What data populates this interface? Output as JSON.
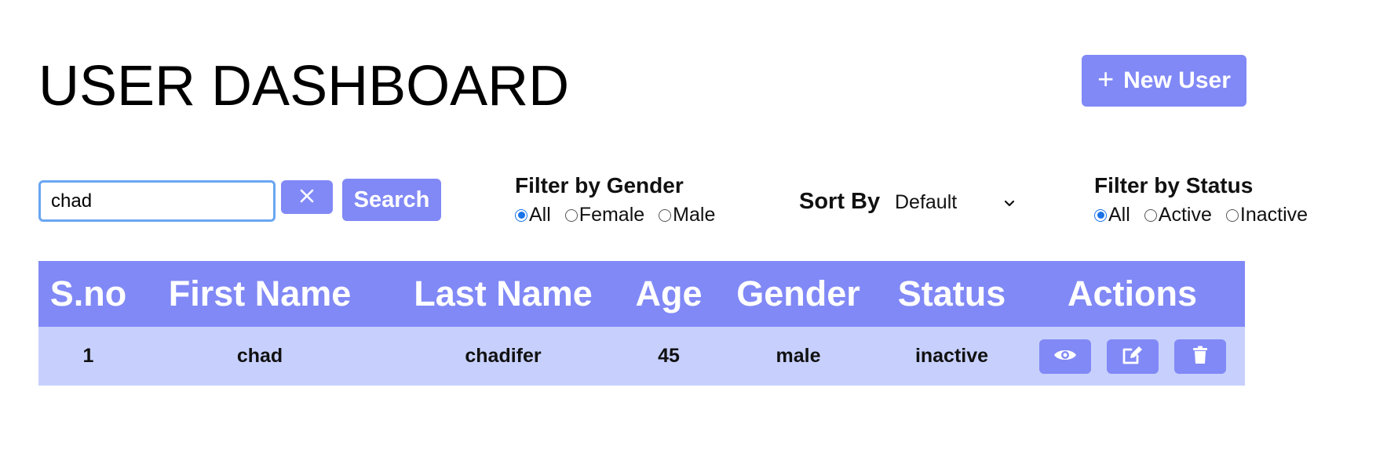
{
  "header": {
    "title": "USER DASHBOARD",
    "new_user_label": "New User",
    "new_user_icon": "plus-icon"
  },
  "search": {
    "value": "chad",
    "placeholder": "",
    "clear_icon": "close-icon",
    "button_label": "Search"
  },
  "gender_filter": {
    "title": "Filter by Gender",
    "options": [
      "All",
      "Female",
      "Male"
    ],
    "selected": "All"
  },
  "sort": {
    "label": "Sort By",
    "selected": "Default",
    "icon": "chevron-down-icon"
  },
  "status_filter": {
    "title": "Filter by Status",
    "options": [
      "All",
      "Active",
      "Inactive"
    ],
    "selected": "All"
  },
  "table": {
    "columns": [
      "S.no",
      "First Name",
      "Last Name",
      "Age",
      "Gender",
      "Status",
      "Actions"
    ],
    "rows": [
      {
        "sno": "1",
        "first_name": "chad",
        "last_name": "chadifer",
        "age": "45",
        "gender": "male",
        "status": "inactive"
      }
    ],
    "action_icons": [
      "eye-icon",
      "edit-icon",
      "trash-icon"
    ]
  },
  "colors": {
    "accent": "#8189f6",
    "row_bg": "#c7d0fd",
    "input_border": "#6aa6f2",
    "radio_checked": "#1a73e8"
  }
}
